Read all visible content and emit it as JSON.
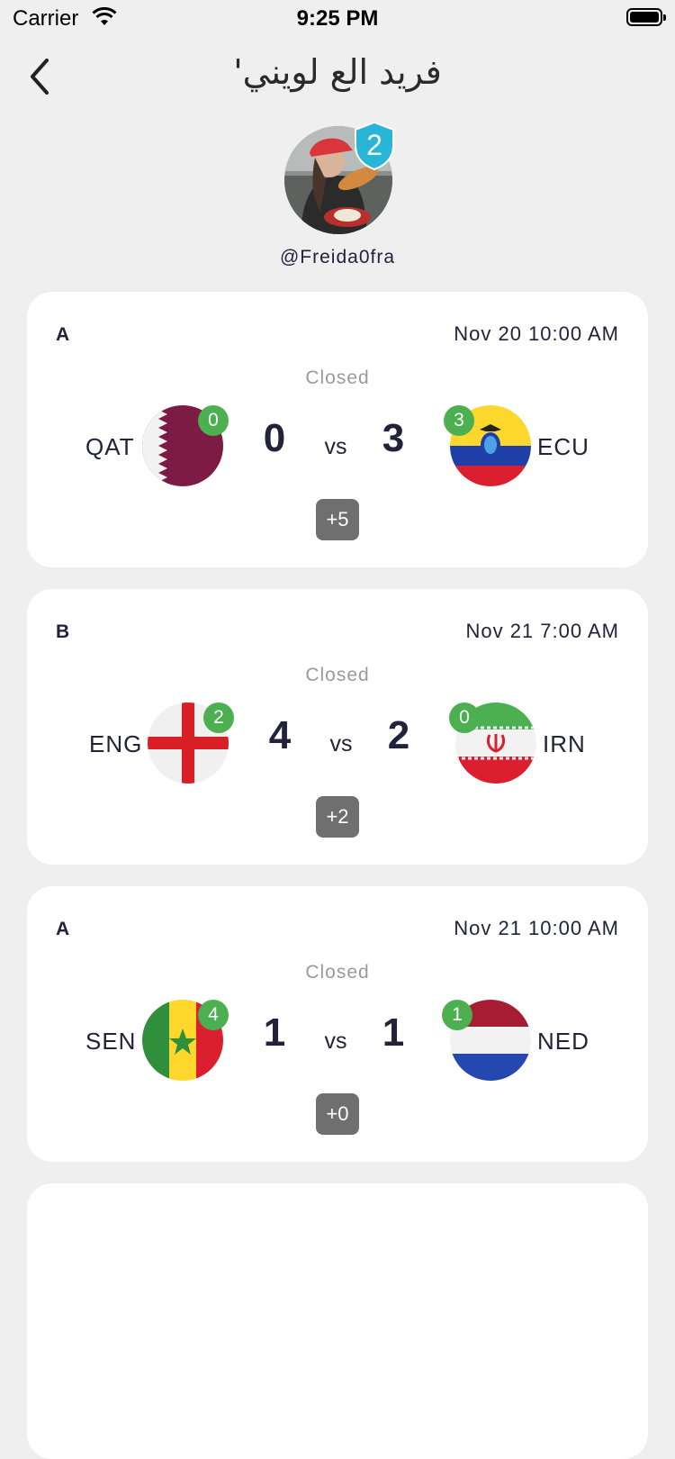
{
  "status_bar": {
    "carrier": "Carrier",
    "time": "9:25 PM"
  },
  "nav": {
    "title": "فريد الع لويني'"
  },
  "profile": {
    "level": "2",
    "username": "@Freida0fra"
  },
  "matches": [
    {
      "group": "A",
      "datetime": "Nov 20 10:00 AM",
      "status": "Closed",
      "home": {
        "code": "QAT",
        "score": "0",
        "picks": "0",
        "flag": "qatar-flag"
      },
      "away": {
        "code": "ECU",
        "score": "3",
        "picks": "3",
        "flag": "ecuador-flag"
      },
      "vs": "vs",
      "more": "+5"
    },
    {
      "group": "B",
      "datetime": "Nov 21 7:00 AM",
      "status": "Closed",
      "home": {
        "code": "ENG",
        "score": "4",
        "picks": "2",
        "flag": "england-flag"
      },
      "away": {
        "code": "IRN",
        "score": "2",
        "picks": "0",
        "flag": "iran-flag"
      },
      "vs": "vs",
      "more": "+2"
    },
    {
      "group": "A",
      "datetime": "Nov 21 10:00 AM",
      "status": "Closed",
      "home": {
        "code": "SEN",
        "score": "1",
        "picks": "4",
        "flag": "senegal-flag"
      },
      "away": {
        "code": "NED",
        "score": "1",
        "picks": "1",
        "flag": "netherlands-flag"
      },
      "vs": "vs",
      "more": "+0"
    }
  ],
  "colors": {
    "background": "#efefef",
    "card": "#ffffff",
    "pick_badge": "#4caf50",
    "level_badge": "#29b6d6",
    "more_button": "#6f6f6f"
  }
}
